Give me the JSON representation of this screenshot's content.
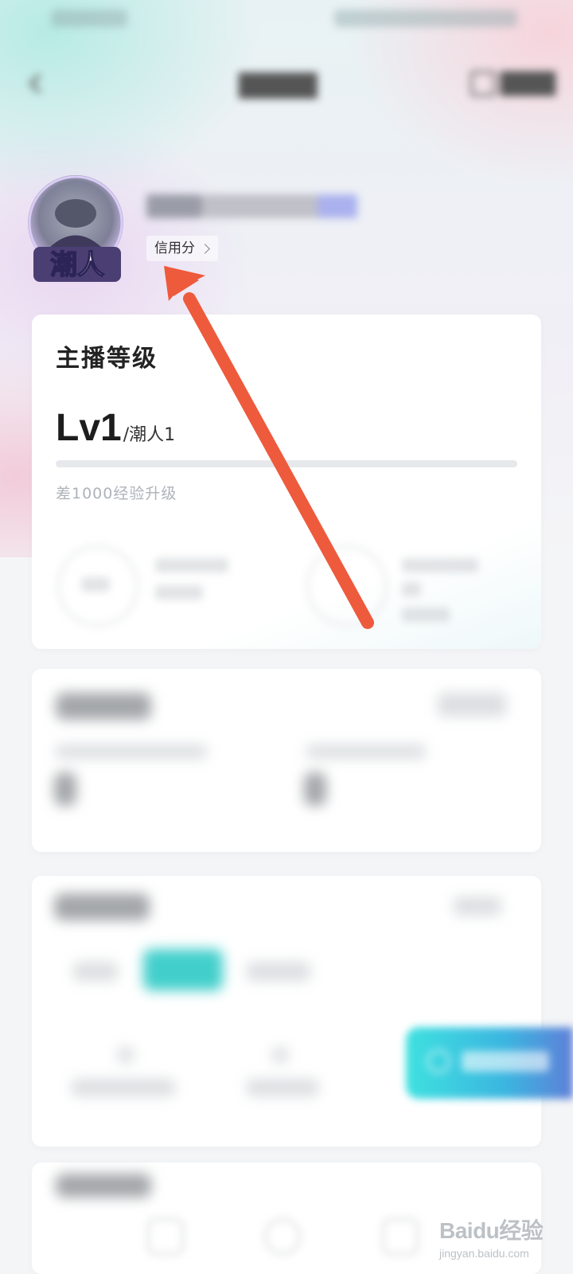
{
  "profile": {
    "credit_label": "信用分"
  },
  "level_card": {
    "title": "主播等级",
    "level": "Lv1",
    "level_name": "/潮人1",
    "exp_text": "差1000经验升级",
    "progress": 0.0
  },
  "colors": {
    "accent": "#42cfcb",
    "arrow": "#ee5a3c"
  },
  "watermark": {
    "brand": "Baidu经验",
    "url": "jingyan.baidu.com"
  }
}
